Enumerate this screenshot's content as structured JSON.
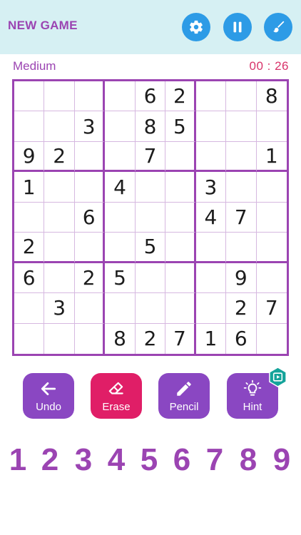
{
  "header": {
    "new_game_label": "NEW GAME",
    "buttons": [
      {
        "name": "settings",
        "icon": "gear-icon"
      },
      {
        "name": "pause",
        "icon": "pause-icon"
      },
      {
        "name": "theme",
        "icon": "paint-brush-icon"
      }
    ]
  },
  "status": {
    "difficulty": "Medium",
    "timer": "00 : 26"
  },
  "board": [
    [
      "",
      "",
      "",
      "",
      "6",
      "2",
      "",
      "",
      "8"
    ],
    [
      "",
      "",
      "3",
      "",
      "8",
      "5",
      "",
      "",
      ""
    ],
    [
      "9",
      "2",
      "",
      "",
      "7",
      "",
      "",
      "",
      "1"
    ],
    [
      "1",
      "",
      "",
      "4",
      "",
      "",
      "3",
      "",
      ""
    ],
    [
      "",
      "",
      "6",
      "",
      "",
      "",
      "4",
      "7",
      ""
    ],
    [
      "2",
      "",
      "",
      "",
      "5",
      "",
      "",
      "",
      ""
    ],
    [
      "6",
      "",
      "2",
      "5",
      "",
      "",
      "",
      "9",
      ""
    ],
    [
      "",
      "3",
      "",
      "",
      "",
      "",
      "",
      "2",
      "7"
    ],
    [
      "",
      "",
      "",
      "8",
      "2",
      "7",
      "1",
      "6",
      ""
    ]
  ],
  "tools": {
    "undo": "Undo",
    "erase": "Erase",
    "pencil": "Pencil",
    "hint": "Hint"
  },
  "numpad": [
    "1",
    "2",
    "3",
    "4",
    "5",
    "6",
    "7",
    "8",
    "9"
  ],
  "colors": {
    "accent": "#9b44b2",
    "header_bg": "#d6f0f3",
    "icon_button": "#2d9be6",
    "erase": "#e01e67",
    "timer": "#d8336a"
  }
}
